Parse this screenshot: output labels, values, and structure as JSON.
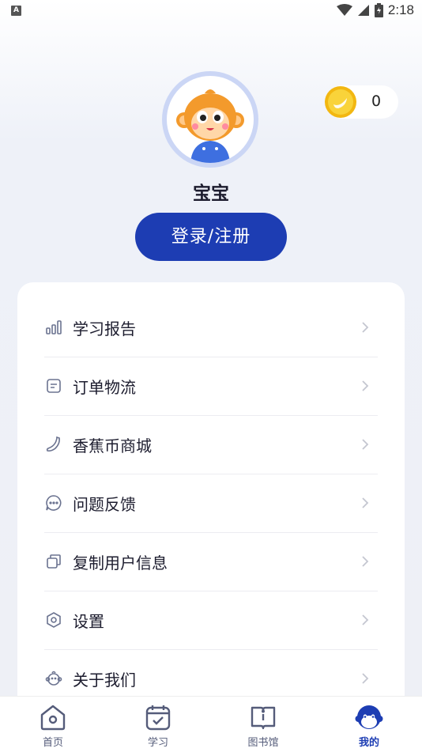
{
  "status_bar": {
    "time": "2:18",
    "left_icon_letter": "A"
  },
  "profile": {
    "username": "宝宝",
    "coins": "0",
    "login_button": "登录/注册"
  },
  "menu": {
    "items": [
      {
        "label": "学习报告",
        "icon": "bar-chart-icon"
      },
      {
        "label": "订单物流",
        "icon": "order-list-icon"
      },
      {
        "label": "香蕉币商城",
        "icon": "banana-icon"
      },
      {
        "label": "问题反馈",
        "icon": "chat-bubble-icon"
      },
      {
        "label": "复制用户信息",
        "icon": "copy-icon"
      },
      {
        "label": "设置",
        "icon": "hexagon-settings-icon"
      },
      {
        "label": "关于我们",
        "icon": "monkey-face-icon"
      }
    ]
  },
  "tabs": [
    {
      "label": "首页",
      "icon": "home-icon"
    },
    {
      "label": "学习",
      "icon": "calendar-check-icon"
    },
    {
      "label": "图书馆",
      "icon": "book-info-icon"
    },
    {
      "label": "我的",
      "icon": "monkey-profile-icon",
      "active": true
    }
  ],
  "colors": {
    "accent": "#1d3db3",
    "icon_gray": "#6b7390",
    "coin_gold": "#f7c51e"
  }
}
